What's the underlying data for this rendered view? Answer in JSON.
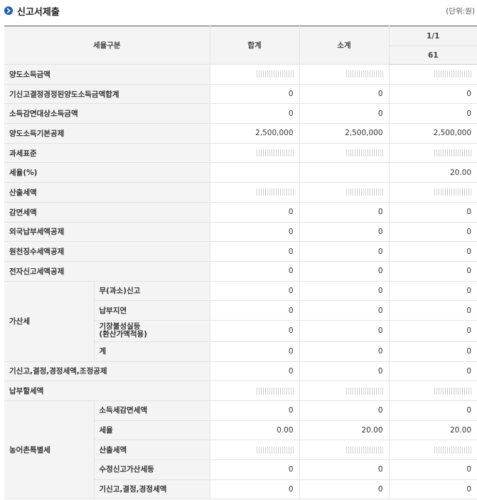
{
  "header": {
    "title": "신고서제출",
    "unit": "(단위:원)"
  },
  "columns": {
    "category": "세율구분",
    "total": "합계",
    "subtotal": "소계",
    "page": "1/1",
    "item_no": "61"
  },
  "rows": [
    {
      "label": "양도소득금액",
      "total": "",
      "subtotal": "",
      "col": ""
    },
    {
      "label": "기신고결정경정된양도소득금액합계",
      "total": "0",
      "subtotal": "0",
      "col": "0"
    },
    {
      "label": "소득감면대상소득금액",
      "total": "0",
      "subtotal": "0",
      "col": "0"
    },
    {
      "label": "양도소득기본공제",
      "total": "2,500,000",
      "subtotal": "2,500,000",
      "col": "2,500,000"
    },
    {
      "label": "과세표준",
      "total": "",
      "subtotal": "",
      "col": ""
    },
    {
      "label": "세율(%)",
      "total": "",
      "subtotal": "",
      "col": "20.00"
    },
    {
      "label": "산출세액",
      "total": "",
      "subtotal": "",
      "col": ""
    },
    {
      "label": "감면세액",
      "total": "0",
      "subtotal": "0",
      "col": "0"
    },
    {
      "label": "외국납부세액공제",
      "total": "0",
      "subtotal": "0",
      "col": "0"
    },
    {
      "label": "원천징수세액공제",
      "total": "0",
      "subtotal": "0",
      "col": "0"
    },
    {
      "label": "전자신고세액공제",
      "total": "0",
      "subtotal": "0",
      "col": "0"
    }
  ],
  "penalty": {
    "label": "가산세",
    "items": [
      {
        "label": "무(과소)신고",
        "total": "0",
        "subtotal": "0",
        "col": "0"
      },
      {
        "label": "납부지연",
        "total": "0",
        "subtotal": "0",
        "col": "0"
      },
      {
        "label": "기장불성실등\n(환산가액적용)",
        "total": "0",
        "subtotal": "0",
        "col": "0"
      },
      {
        "label": "계",
        "total": "0",
        "subtotal": "0",
        "col": "0"
      }
    ]
  },
  "rows2": [
    {
      "label": "기신고,결정,경정세액,조정공제",
      "total": "0",
      "subtotal": "0",
      "col": "0"
    },
    {
      "label": "납부할세액",
      "total": "",
      "subtotal": "",
      "col": ""
    }
  ],
  "rural": {
    "label": "농어촌특별세",
    "items": [
      {
        "label": "소득세감면세액",
        "total": "0",
        "subtotal": "0",
        "col": "0"
      },
      {
        "label": "세율",
        "total": "0.00",
        "subtotal": "20.00",
        "col": "20.00"
      },
      {
        "label": "산출세액",
        "total": "0",
        "subtotal": "0",
        "col": "0"
      },
      {
        "label": "수정신고가산세등",
        "total": "0",
        "subtotal": "0",
        "col": "0"
      },
      {
        "label": "기신고,결정,경정세액",
        "total": "0",
        "subtotal": "0",
        "col": "0"
      }
    ]
  },
  "masked_cells": {
    "양도소득금액": [
      true,
      true,
      true
    ],
    "과세표준": [
      true,
      true,
      true
    ],
    "산출세액": [
      true,
      true,
      true
    ],
    "납부할세액": [
      true,
      true,
      true
    ]
  },
  "colors": {
    "header_bg": "#f4f4f4",
    "icon_blue": "#1f5fa8",
    "border": "#e3e3e3"
  }
}
